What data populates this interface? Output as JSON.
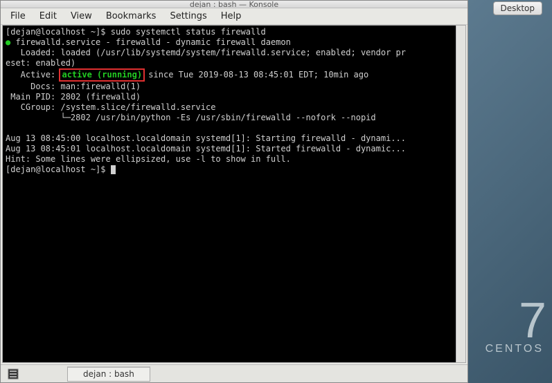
{
  "desktop": {
    "button_label": "Desktop",
    "wallpaper_version": "7",
    "wallpaper_distro": "CENTOS"
  },
  "window": {
    "title": "dejan : bash — Konsole",
    "menu": [
      "File",
      "Edit",
      "View",
      "Bookmarks",
      "Settings",
      "Help"
    ],
    "taskbar_label": "dejan : bash"
  },
  "terminal": {
    "prompt1_user": "[dejan@localhost ~]$ ",
    "prompt1_cmd": "sudo systemctl status firewalld",
    "svc_line": " firewalld.service - firewalld - dynamic firewall daemon",
    "loaded": "   Loaded: loaded (/usr/lib/systemd/system/firewalld.service; enabled; vendor pr",
    "loaded2": "eset: enabled)",
    "active_label": "   Active: ",
    "active_status": "active (running)",
    "active_rest": " since Tue 2019-08-13 08:45:01 EDT; 10min ago",
    "docs": "     Docs: man:firewalld(1)",
    "mainpid": " Main PID: 2802 (firewalld)",
    "cgroup": "   CGroup: /system.slice/firewalld.service",
    "cgroup2": "           └─2802 /usr/bin/python -Es /usr/sbin/firewalld --nofork --nopid",
    "log1": "Aug 13 08:45:00 localhost.localdomain systemd[1]: Starting firewalld - dynami...",
    "log2": "Aug 13 08:45:01 localhost.localdomain systemd[1]: Started firewalld - dynamic...",
    "hint": "Hint: Some lines were ellipsized, use -l to show in full.",
    "prompt2": "[dejan@localhost ~]$ "
  }
}
